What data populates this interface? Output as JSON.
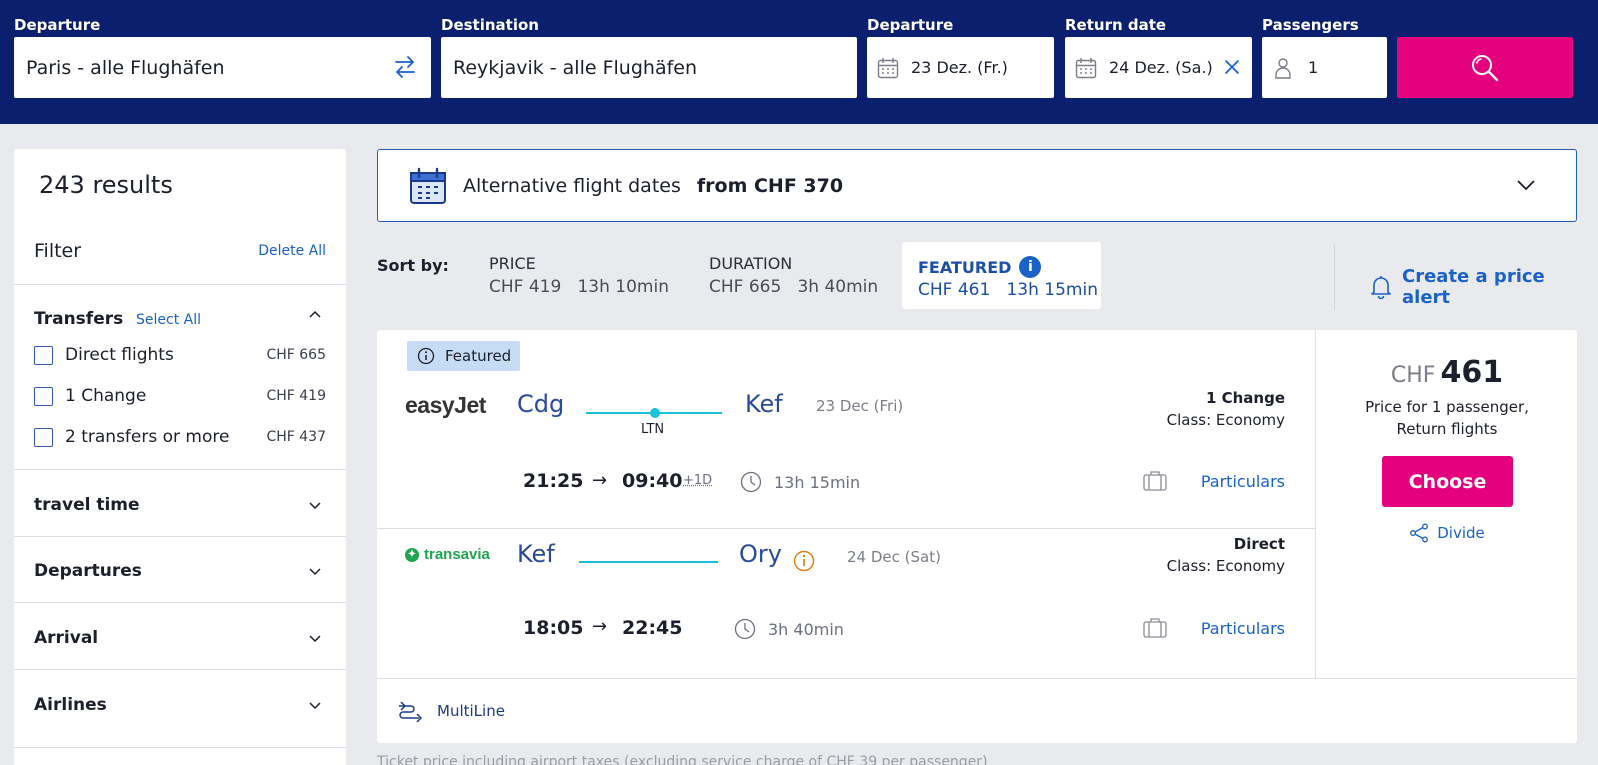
{
  "search": {
    "departure_label": "Departure",
    "departure_value": "Paris - alle Flughäfen",
    "destination_label": "Destination",
    "destination_value": "Reykjavik - alle Flughäfen",
    "date_label": "Departure",
    "date_value": "23 Dez. (Fr.)",
    "return_label": "Return date",
    "return_value": "24 Dez. (Sa.)",
    "passengers_label": "Passengers",
    "passengers_value": "1"
  },
  "sidebar": {
    "results": "243 results",
    "filter": "Filter",
    "delete_all": "Delete All",
    "transfers": {
      "title": "Transfers",
      "select_all": "Select All",
      "options": [
        {
          "label": "Direct flights",
          "price": "CHF 665"
        },
        {
          "label": "1 Change",
          "price": "CHF 419"
        },
        {
          "label": "2 transfers or more",
          "price": "CHF 437"
        }
      ]
    },
    "sections": [
      "travel time",
      "Departures",
      "Arrival",
      "Airlines"
    ]
  },
  "alt_dates": {
    "text": "Alternative flight dates",
    "from": "from CHF 370"
  },
  "sort": {
    "label": "Sort by:",
    "price": {
      "title": "PRICE",
      "value": "CHF 419   13h 10min"
    },
    "duration": {
      "title": "DURATION",
      "value": "CHF 665   3h 40min"
    },
    "featured": {
      "title": "FEATURED",
      "value": "CHF 461   13h 15min"
    },
    "price_alert": "Create a price alert"
  },
  "result": {
    "badge": "Featured",
    "outbound": {
      "airline": "easyJet",
      "from": "Cdg",
      "via": "LTN",
      "to": "Kef",
      "date": "23 Dec (Fri)",
      "changes": "1 Change",
      "class": "Class: Economy",
      "dep_time": "21:25",
      "arr_time": "09:40",
      "plus": "+1D",
      "duration": "13h 15min",
      "details": "Particulars"
    },
    "inbound": {
      "airline": "transavia",
      "from": "Kef",
      "to": "Ory",
      "date": "24 Dec (Sat)",
      "changes": "Direct",
      "class": "Class: Economy",
      "dep_time": "18:05",
      "arr_time": "22:45",
      "duration": "3h 40min",
      "details": "Particulars"
    },
    "currency": "CHF",
    "price": "461",
    "price_note_1": "Price for 1 passenger,",
    "price_note_2": "Return flights",
    "choose": "Choose",
    "divide": "Divide",
    "footer": "MultiLine"
  },
  "disclaimer": "Ticket price including airport taxes (excluding service charge of CHF 39 per passenger)",
  "colors": {
    "header_bg": "#0a1f6e",
    "accent_pink": "#e5007d",
    "link_blue": "#1a62c9",
    "route_cyan": "#18c0d9"
  }
}
